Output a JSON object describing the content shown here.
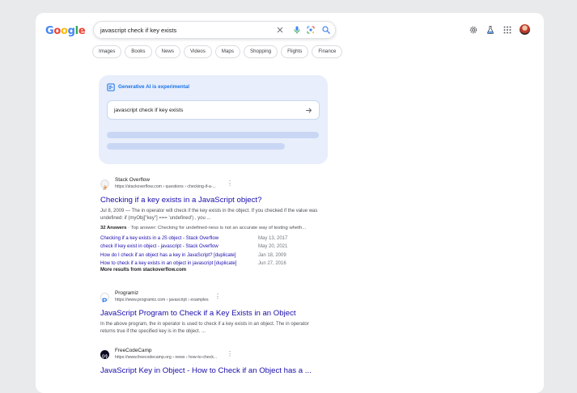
{
  "logo": [
    "G",
    "o",
    "o",
    "g",
    "l",
    "e"
  ],
  "search": {
    "query": "javascript check if key exists"
  },
  "icons": {
    "clear": "close-icon",
    "voice": "mic-icon",
    "lens": "lens-icon",
    "search": "search-icon",
    "settings": "gear-icon",
    "labs": "flask-icon",
    "apps": "apps-grid-icon"
  },
  "chips": [
    "Images",
    "Books",
    "News",
    "Videos",
    "Maps",
    "Shopping",
    "Flights",
    "Finance"
  ],
  "ai": {
    "title": "Generative AI is experimental",
    "query": "javascript check if key exists"
  },
  "results": [
    {
      "site": "Stack Overflow",
      "url": "https://stackoverflow.com › questions › checking-if-a-...",
      "title": "Checking if a key exists in a JavaScript object?",
      "snippet_date": "Jul 8, 2009 —",
      "snippet": "The in operator will check if the key exists in the object. If you checked if the value was undefined: if (myObj[\"key\"] === 'undefined') , you ...",
      "answers_count": "32 Answers",
      "answers_text": "· Top answer: Checking for undefined-ness is not an accurate way of testing wheth...",
      "subresults": [
        {
          "label": "Checking if a key exists in a JS object - Stack Overflow",
          "date": "May 13, 2017"
        },
        {
          "label": "check if key exist in object - javascript - Stack Overflow",
          "date": "May 20, 2021"
        },
        {
          "label": "How do I check if an object has a key in JavaScript? [duplicate]",
          "date": "Jan 18, 2009"
        },
        {
          "label": "How to check if a key exists in an object in javascript [duplicate]",
          "date": "Jun 27, 2016"
        }
      ],
      "more": "More results from stackoverflow.com"
    },
    {
      "site": "Programiz",
      "url": "https://www.programiz.com › javascript › examples",
      "title": "JavaScript Program to Check if a Key Exists in an Object",
      "snippet": "In the above program, the in operator is used to check if a key exists in an object. The in operator returns true if the specified key is in the object. ..."
    },
    {
      "site": "FreeCodeCamp",
      "url": "https://www.freecodecamp.org › news › how-to-check...",
      "title": "JavaScript Key in Object - How to Check if an Object has a ..."
    }
  ]
}
